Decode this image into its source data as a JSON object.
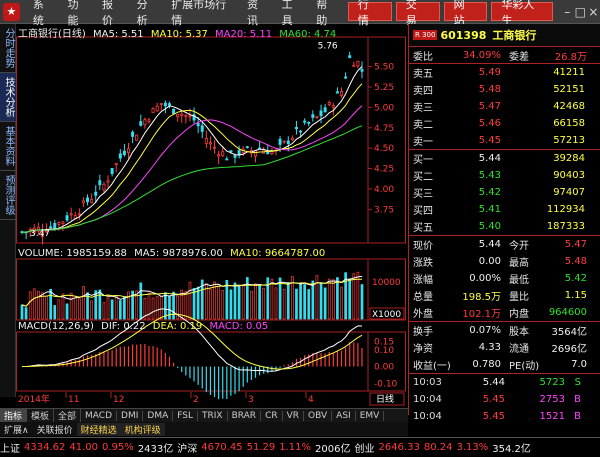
{
  "menubar": {
    "logo_glyph": "★",
    "menus": [
      "系统",
      "功能",
      "报价",
      "分析",
      "扩展市场行情",
      "资讯",
      "工具",
      "帮助"
    ],
    "tabs": [
      "行 情",
      "交 易",
      "网 站",
      "华彩人生"
    ]
  },
  "sidetabs": [
    "分时走势",
    "技术分析",
    "基本资料",
    "预测评级"
  ],
  "kline": {
    "title": "工商银行(日线)",
    "ma5": "MA5: 5.51",
    "ma10": "MA10: 5.37",
    "ma20": "MA20: 5.11",
    "ma60": "MA60: 4.74",
    "high_label": "5.76",
    "low_label": "3.47",
    "price_ticks": [
      "5.50",
      "5.25",
      "5.00",
      "4.75",
      "4.50",
      "4.25",
      "4.00",
      "3.75"
    ]
  },
  "volume": {
    "label": "VOLUME: 1985159.88",
    "ma5": "MA5: 9878976.00",
    "ma10": "MA10: 9664787.00",
    "tick": "10000",
    "unit": "X1000"
  },
  "macd": {
    "label": "MACD(12,26,9)",
    "dif": "DIF: 0.22",
    "dea": "DEA: 0.19",
    "macd": "MACD: 0.05",
    "ticks": [
      "0.15",
      "0.10",
      "0.00",
      "-0.10"
    ]
  },
  "dates": {
    "year": "2014年",
    "months": [
      "11",
      "12",
      "2",
      "3",
      "4"
    ],
    "period": "日线"
  },
  "bottom_tabs": [
    "指标",
    "模板",
    "全部",
    "MACD",
    "DMI",
    "DMA",
    "FSL",
    "TRIX",
    "BRAR",
    "CR",
    "VR",
    "OBV",
    "ASI",
    "EMV"
  ],
  "nav_tabs": [
    "扩展∧",
    "关联报价",
    "财经精选",
    "机构评级"
  ],
  "quote": {
    "badge": "R 300",
    "code": "601398",
    "name": "工商银行",
    "weibi_label": "委比",
    "weibi": "34.09%",
    "weicha_label": "委差",
    "weicha": "26.8万",
    "sell": [
      {
        "label": "卖五",
        "price": "5.49",
        "vol": "41211"
      },
      {
        "label": "卖四",
        "price": "5.48",
        "vol": "52151"
      },
      {
        "label": "卖三",
        "price": "5.47",
        "vol": "42468"
      },
      {
        "label": "卖二",
        "price": "5.46",
        "vol": "66158"
      },
      {
        "label": "卖一",
        "price": "5.45",
        "vol": "57213"
      }
    ],
    "buy": [
      {
        "label": "买一",
        "price": "5.44",
        "vol": "39284"
      },
      {
        "label": "买二",
        "price": "5.43",
        "vol": "90403"
      },
      {
        "label": "买三",
        "price": "5.42",
        "vol": "97407"
      },
      {
        "label": "买四",
        "price": "5.41",
        "vol": "112934"
      },
      {
        "label": "买五",
        "price": "5.40",
        "vol": "187333"
      }
    ],
    "stats": [
      {
        "l1": "现价",
        "v1": "5.44",
        "l2": "今开",
        "v2": "5.47"
      },
      {
        "l1": "涨跌",
        "v1": "0.00",
        "l2": "最高",
        "v2": "5.48"
      },
      {
        "l1": "涨幅",
        "v1": "0.00%",
        "l2": "最低",
        "v2": "5.42"
      },
      {
        "l1": "总量",
        "v1": "198.5万",
        "l2": "量比",
        "v2": "1.15"
      },
      {
        "l1": "外盘",
        "v1": "102.1万",
        "l2": "内盘",
        "v2": "964600"
      }
    ],
    "info": [
      {
        "l1": "换手",
        "v1": "0.07%",
        "l2": "股本",
        "v2": "3564亿"
      },
      {
        "l1": "净资",
        "v1": "4.33",
        "l2": "流通",
        "v2": "2696亿"
      },
      {
        "l1": "收益(一)",
        "v1": "0.780",
        "l2": "PE(动)",
        "v2": "7.0"
      }
    ],
    "ticks": [
      {
        "time": "10:03",
        "price": "5.44",
        "vol": "5723",
        "flag": "S"
      },
      {
        "time": "10:04",
        "price": "5.45",
        "vol": "2753",
        "flag": "B"
      },
      {
        "time": "10:04",
        "price": "5.45",
        "vol": "1521",
        "flag": "B"
      }
    ]
  },
  "ticker": [
    {
      "name": "上证",
      "value": "4334.62",
      "chg": "41.00",
      "pct": "0.95%",
      "amt": "2433亿"
    },
    {
      "name": "沪深",
      "value": "4670.45",
      "chg": "51.29",
      "pct": "1.11%",
      "amt": "2006亿"
    },
    {
      "name": "创业",
      "value": "2646.33",
      "chg": "80.24",
      "pct": "3.13%",
      "amt": "354.2亿"
    }
  ],
  "colors": {
    "up": "#ff3b3b",
    "down": "#2fe02f",
    "ma5": "#ffffff",
    "ma10": "#ffff44",
    "ma20": "#ff44ff",
    "ma60": "#2fe02f",
    "frame": "#aa2222"
  }
}
